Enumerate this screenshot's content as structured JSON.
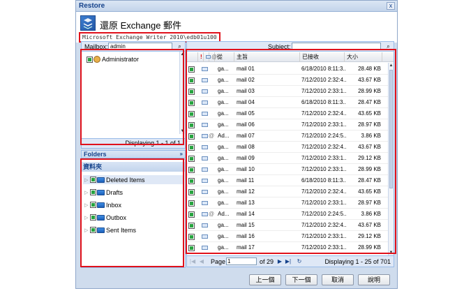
{
  "window": {
    "title": "Restore",
    "close_glyph": "x"
  },
  "header": {
    "heading": "還原 Exchange 郵件",
    "path": "Microsoft Exchange Writer 2010\\edb01u100",
    "logo_icon": "exchange-restore-icon"
  },
  "mailbox": {
    "label": "Mailbox:",
    "value": "admin",
    "items": [
      {
        "label": "Administrator"
      }
    ],
    "footer": "Displaying 1 - 1 of 1"
  },
  "folders": {
    "title": "Folders",
    "collapse_glyph": "»",
    "root": "資料夾",
    "items": [
      {
        "label": "Deleted Items"
      },
      {
        "label": "Drafts"
      },
      {
        "label": "Inbox"
      },
      {
        "label": "Outbox"
      },
      {
        "label": "Sent Items"
      }
    ]
  },
  "messages": {
    "subject_label": "Subject:",
    "columns": {
      "importance": "!",
      "from": "從",
      "subject": "主旨",
      "received": "已接收",
      "size": "大小"
    },
    "rows": [
      {
        "from": "ga...",
        "subject": "mail 01",
        "received": "6/18/2010 8:11:3...",
        "size": "28.48 KB",
        "attach": false
      },
      {
        "from": "ga...",
        "subject": "mail 02",
        "received": "7/12/2010 2:32:4...",
        "size": "43.67 KB",
        "attach": false
      },
      {
        "from": "ga...",
        "subject": "mail 03",
        "received": "7/12/2010 2:33:1...",
        "size": "28.99 KB",
        "attach": false
      },
      {
        "from": "ga...",
        "subject": "mail 04",
        "received": "6/18/2010 8:11:3...",
        "size": "28.47 KB",
        "attach": false
      },
      {
        "from": "ga...",
        "subject": "mail 05",
        "received": "7/12/2010 2:32:4...",
        "size": "43.65 KB",
        "attach": false
      },
      {
        "from": "ga...",
        "subject": "mail 06",
        "received": "7/12/2010 2:33:1...",
        "size": "28.97 KB",
        "attach": false
      },
      {
        "from": "Ad...",
        "subject": "mail 07",
        "received": "7/12/2010 2:24:5...",
        "size": "3.86 KB",
        "attach": true
      },
      {
        "from": "ga...",
        "subject": "mail 08",
        "received": "7/12/2010 2:32:4...",
        "size": "43.67 KB",
        "attach": false
      },
      {
        "from": "ga...",
        "subject": "mail 09",
        "received": "7/12/2010 2:33:1...",
        "size": "29.12 KB",
        "attach": false
      },
      {
        "from": "ga...",
        "subject": "mail 10",
        "received": "7/12/2010 2:33:1...",
        "size": "28.99 KB",
        "attach": false
      },
      {
        "from": "ga...",
        "subject": "mail 11",
        "received": "6/18/2010 8:11:3...",
        "size": "28.47 KB",
        "attach": false
      },
      {
        "from": "ga...",
        "subject": "mail 12",
        "received": "7/12/2010 2:32:4...",
        "size": "43.65 KB",
        "attach": false
      },
      {
        "from": "ga...",
        "subject": "mail 13",
        "received": "7/12/2010 2:33:1...",
        "size": "28.97 KB",
        "attach": false
      },
      {
        "from": "Ad...",
        "subject": "mail 14",
        "received": "7/12/2010 2:24:5...",
        "size": "3.86 KB",
        "attach": true
      },
      {
        "from": "ga...",
        "subject": "mail 15",
        "received": "7/12/2010 2:32:4...",
        "size": "43.67 KB",
        "attach": false
      },
      {
        "from": "ga...",
        "subject": "mail 16",
        "received": "7/12/2010 2:33:1...",
        "size": "29.12 KB",
        "attach": false
      },
      {
        "from": "ga...",
        "subject": "mail 17",
        "received": "7/12/2010 2:33:1...",
        "size": "28.99 KB",
        "attach": false
      }
    ]
  },
  "pager": {
    "page_label": "Page",
    "page_value": "1",
    "of_label": "of 29",
    "display": "Displaying 1 - 25 of 701"
  },
  "buttons": {
    "prev": "上一個",
    "next": "下一個",
    "cancel": "取消",
    "help": "說明"
  },
  "colors": {
    "highlight": "#e0111b",
    "panel_bg": "#dfe8f6",
    "accent": "#15428b"
  }
}
